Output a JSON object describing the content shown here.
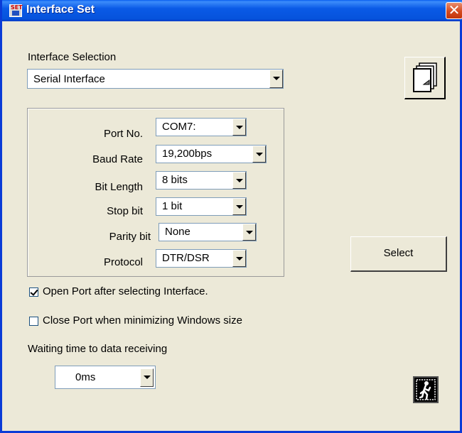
{
  "window": {
    "title": "Interface Set",
    "close_glyph": "✕"
  },
  "interface": {
    "section_label": "Interface Selection",
    "selected": "Serial Interface"
  },
  "settings": {
    "port_label": "Port No.",
    "port_value": "COM7:",
    "baud_label": "Baud Rate",
    "baud_value": "19,200bps",
    "bits_label": "Bit Length",
    "bits_value": "8 bits",
    "stop_label": "Stop bit",
    "stop_value": "1 bit",
    "parity_label": "Parity bit",
    "parity_value": "None",
    "protocol_label": "Protocol",
    "protocol_value": "DTR/DSR"
  },
  "buttons": {
    "select_label": "Select"
  },
  "options": {
    "open_port_label": "Open Port after selecting Interface.",
    "open_port_checked": true,
    "close_port_label": "Close Port when minimizing Windows size",
    "close_port_checked": false
  },
  "waiting": {
    "label": "Waiting time to data receiving",
    "value": "0ms"
  },
  "icons": {
    "title": "app-set-icon",
    "pages": "pages-icon",
    "exit": "exit-door-icon"
  }
}
